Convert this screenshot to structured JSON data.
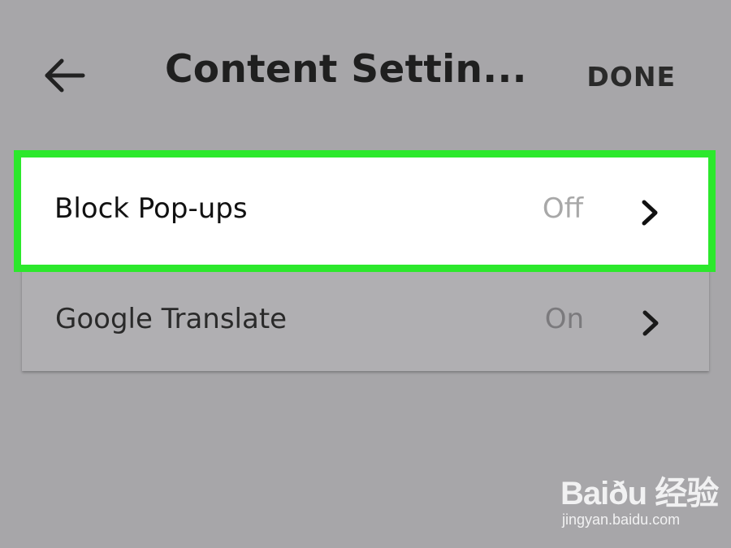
{
  "header": {
    "back_icon": "arrow-left-icon",
    "title": "Content Settin...",
    "done_label": "DONE"
  },
  "settings": [
    {
      "label": "Block Pop-ups",
      "value": "Off",
      "icon": "chevron-right-icon",
      "highlighted": true
    },
    {
      "label": "Google Translate",
      "value": "On",
      "icon": "chevron-right-icon",
      "highlighted": false
    }
  ],
  "colors": {
    "background": "#a7a6a9",
    "highlight_border": "#2ce82c",
    "row_highlight_bg": "#ffffff",
    "row_bg": "#b0afb2"
  },
  "watermark": {
    "logo": "Baiðu 经验",
    "url": "jingyan.baidu.com"
  }
}
